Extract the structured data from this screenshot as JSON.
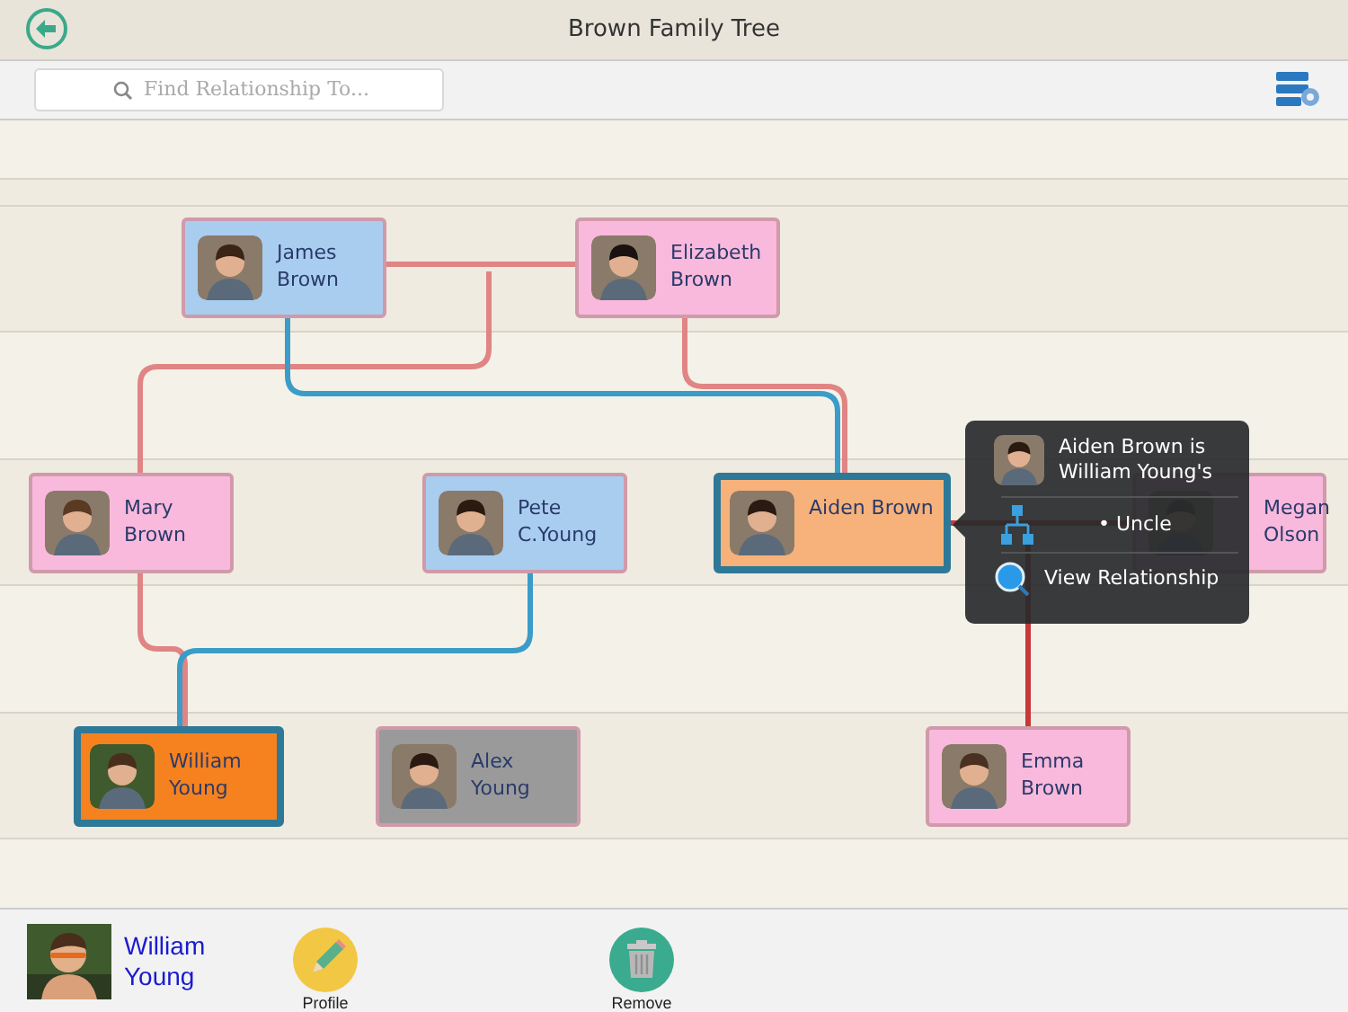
{
  "window": {
    "title": "Brown Family Tree"
  },
  "search": {
    "placeholder": "Find Relationship To..."
  },
  "people": [
    {
      "name": "James Brown",
      "color": "#a9cdef",
      "selected": false
    },
    {
      "name": "Elizabeth Brown",
      "color": "#f9b9dc",
      "selected": false
    },
    {
      "name": "Mary Brown",
      "color": "#f9b9dc",
      "selected": false
    },
    {
      "name": "Pete C.Young",
      "color": "#a9cdef",
      "selected": false
    },
    {
      "name": "Aiden Brown",
      "color": "#f6b27a",
      "selected": true
    },
    {
      "name": "Megan Olson",
      "color": "#f9b9dc",
      "selected": false
    },
    {
      "name": "William Young",
      "color": "#f5821f",
      "selected": true
    },
    {
      "name": "Alex Young",
      "color": "#9a9a9a",
      "selected": false
    },
    {
      "name": "Emma Brown",
      "color": "#f9b9dc",
      "selected": false
    }
  ],
  "popover": {
    "title": "Aiden Brown is William Young's",
    "relation": "• Uncle",
    "action": "View Relationship"
  },
  "footer": {
    "person": "William Young",
    "buttons": [
      {
        "label": "Profile",
        "kind": "edit"
      },
      {
        "label": "Remove",
        "kind": "delete"
      }
    ]
  }
}
